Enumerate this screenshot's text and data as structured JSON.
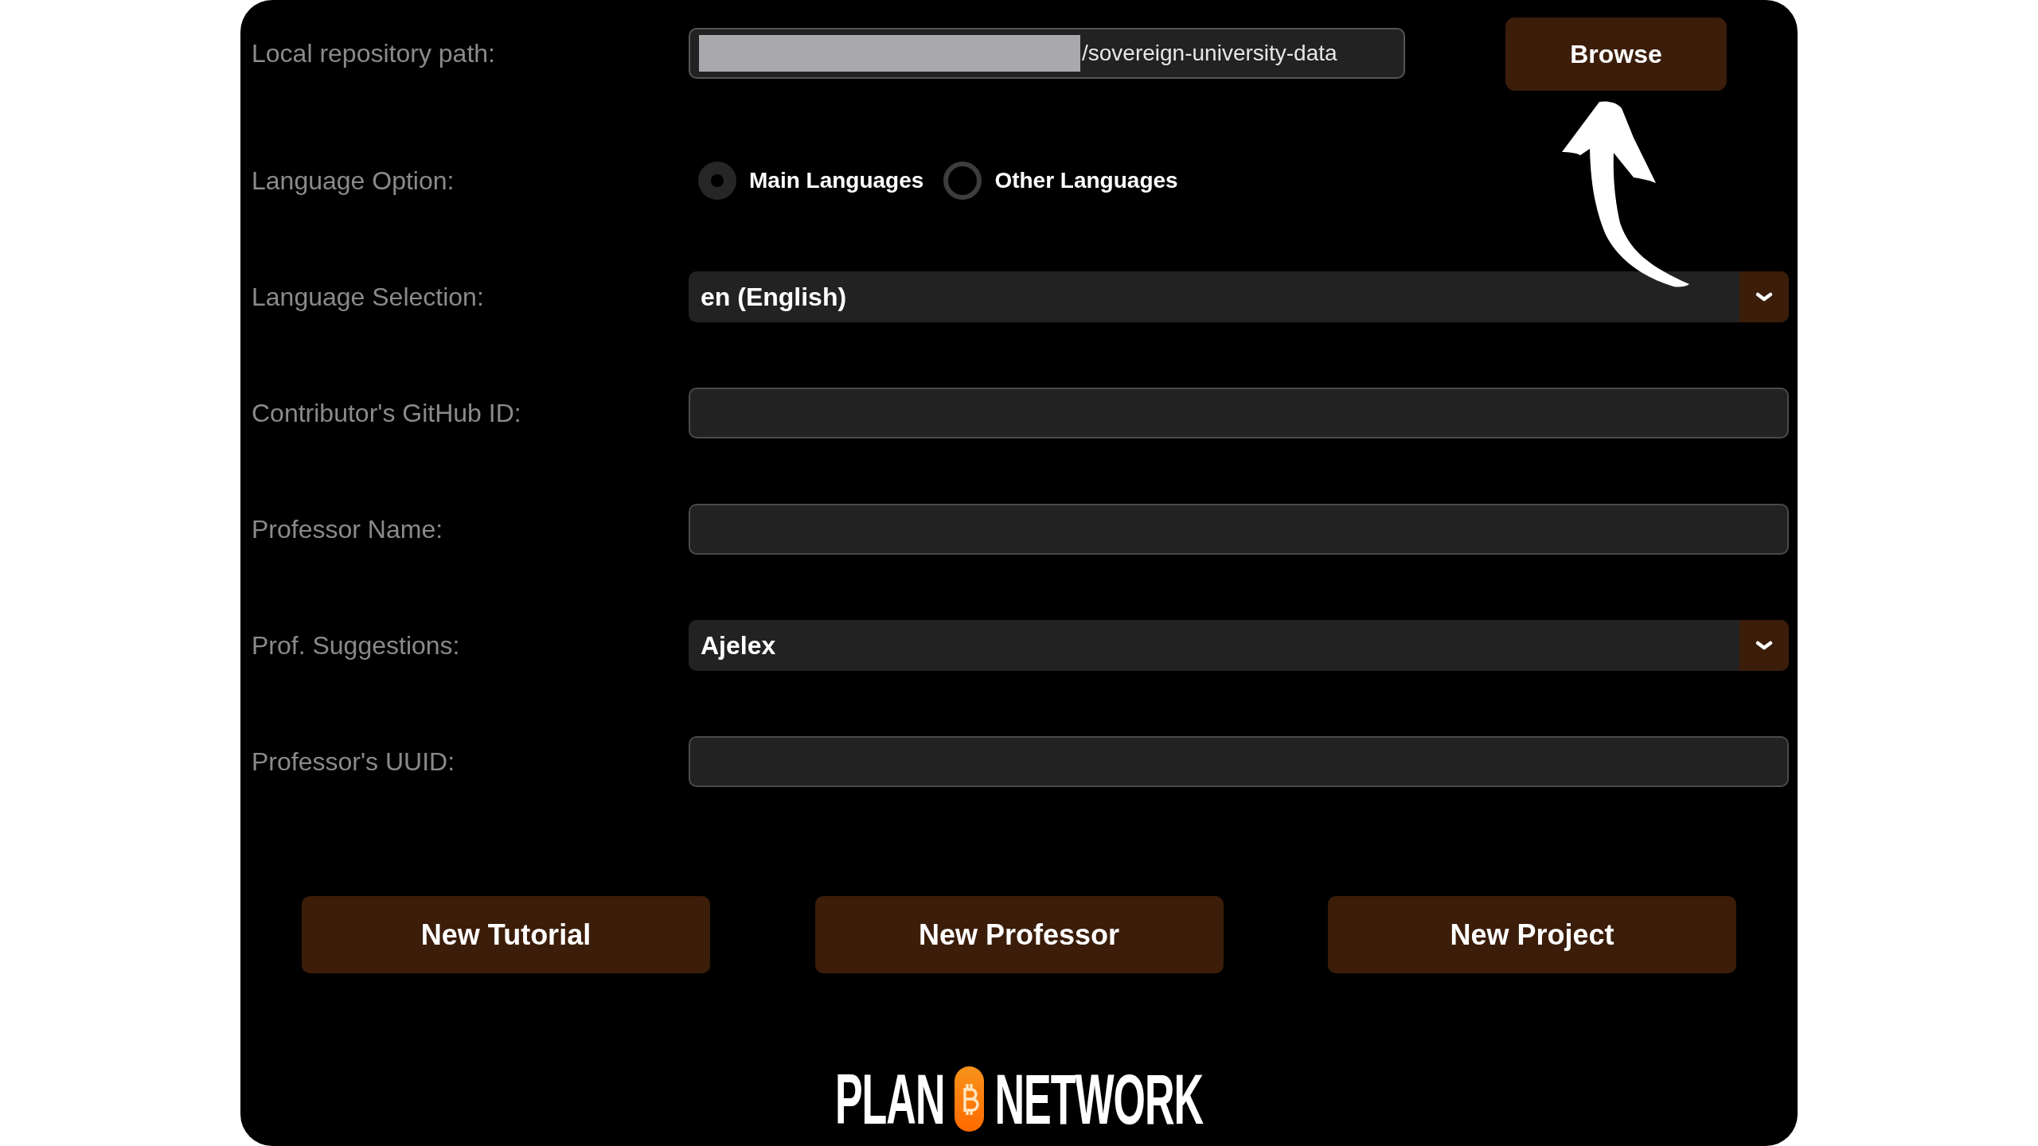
{
  "form": {
    "rows": [
      {
        "kind": "path",
        "label": "Local repository path:",
        "value": "/sovereign-university-data",
        "button": "Browse"
      },
      {
        "kind": "radio",
        "label": "Language Option:",
        "options": [
          {
            "label": "Main Languages",
            "selected": true
          },
          {
            "label": "Other Languages",
            "selected": false
          }
        ]
      },
      {
        "kind": "select",
        "label": "Language Selection:",
        "value": "en (English)"
      },
      {
        "kind": "text",
        "label": "Contributor's GitHub ID:"
      },
      {
        "kind": "text",
        "label": "Professor Name:"
      },
      {
        "kind": "select",
        "label": "Prof. Suggestions:",
        "value": "Ajelex"
      },
      {
        "kind": "text",
        "label": "Professor's UUID:"
      }
    ]
  },
  "actions": [
    "New Tutorial",
    "New Professor",
    "New Project"
  ],
  "logo": {
    "left": "PLAN",
    "right": "NETWORK"
  }
}
